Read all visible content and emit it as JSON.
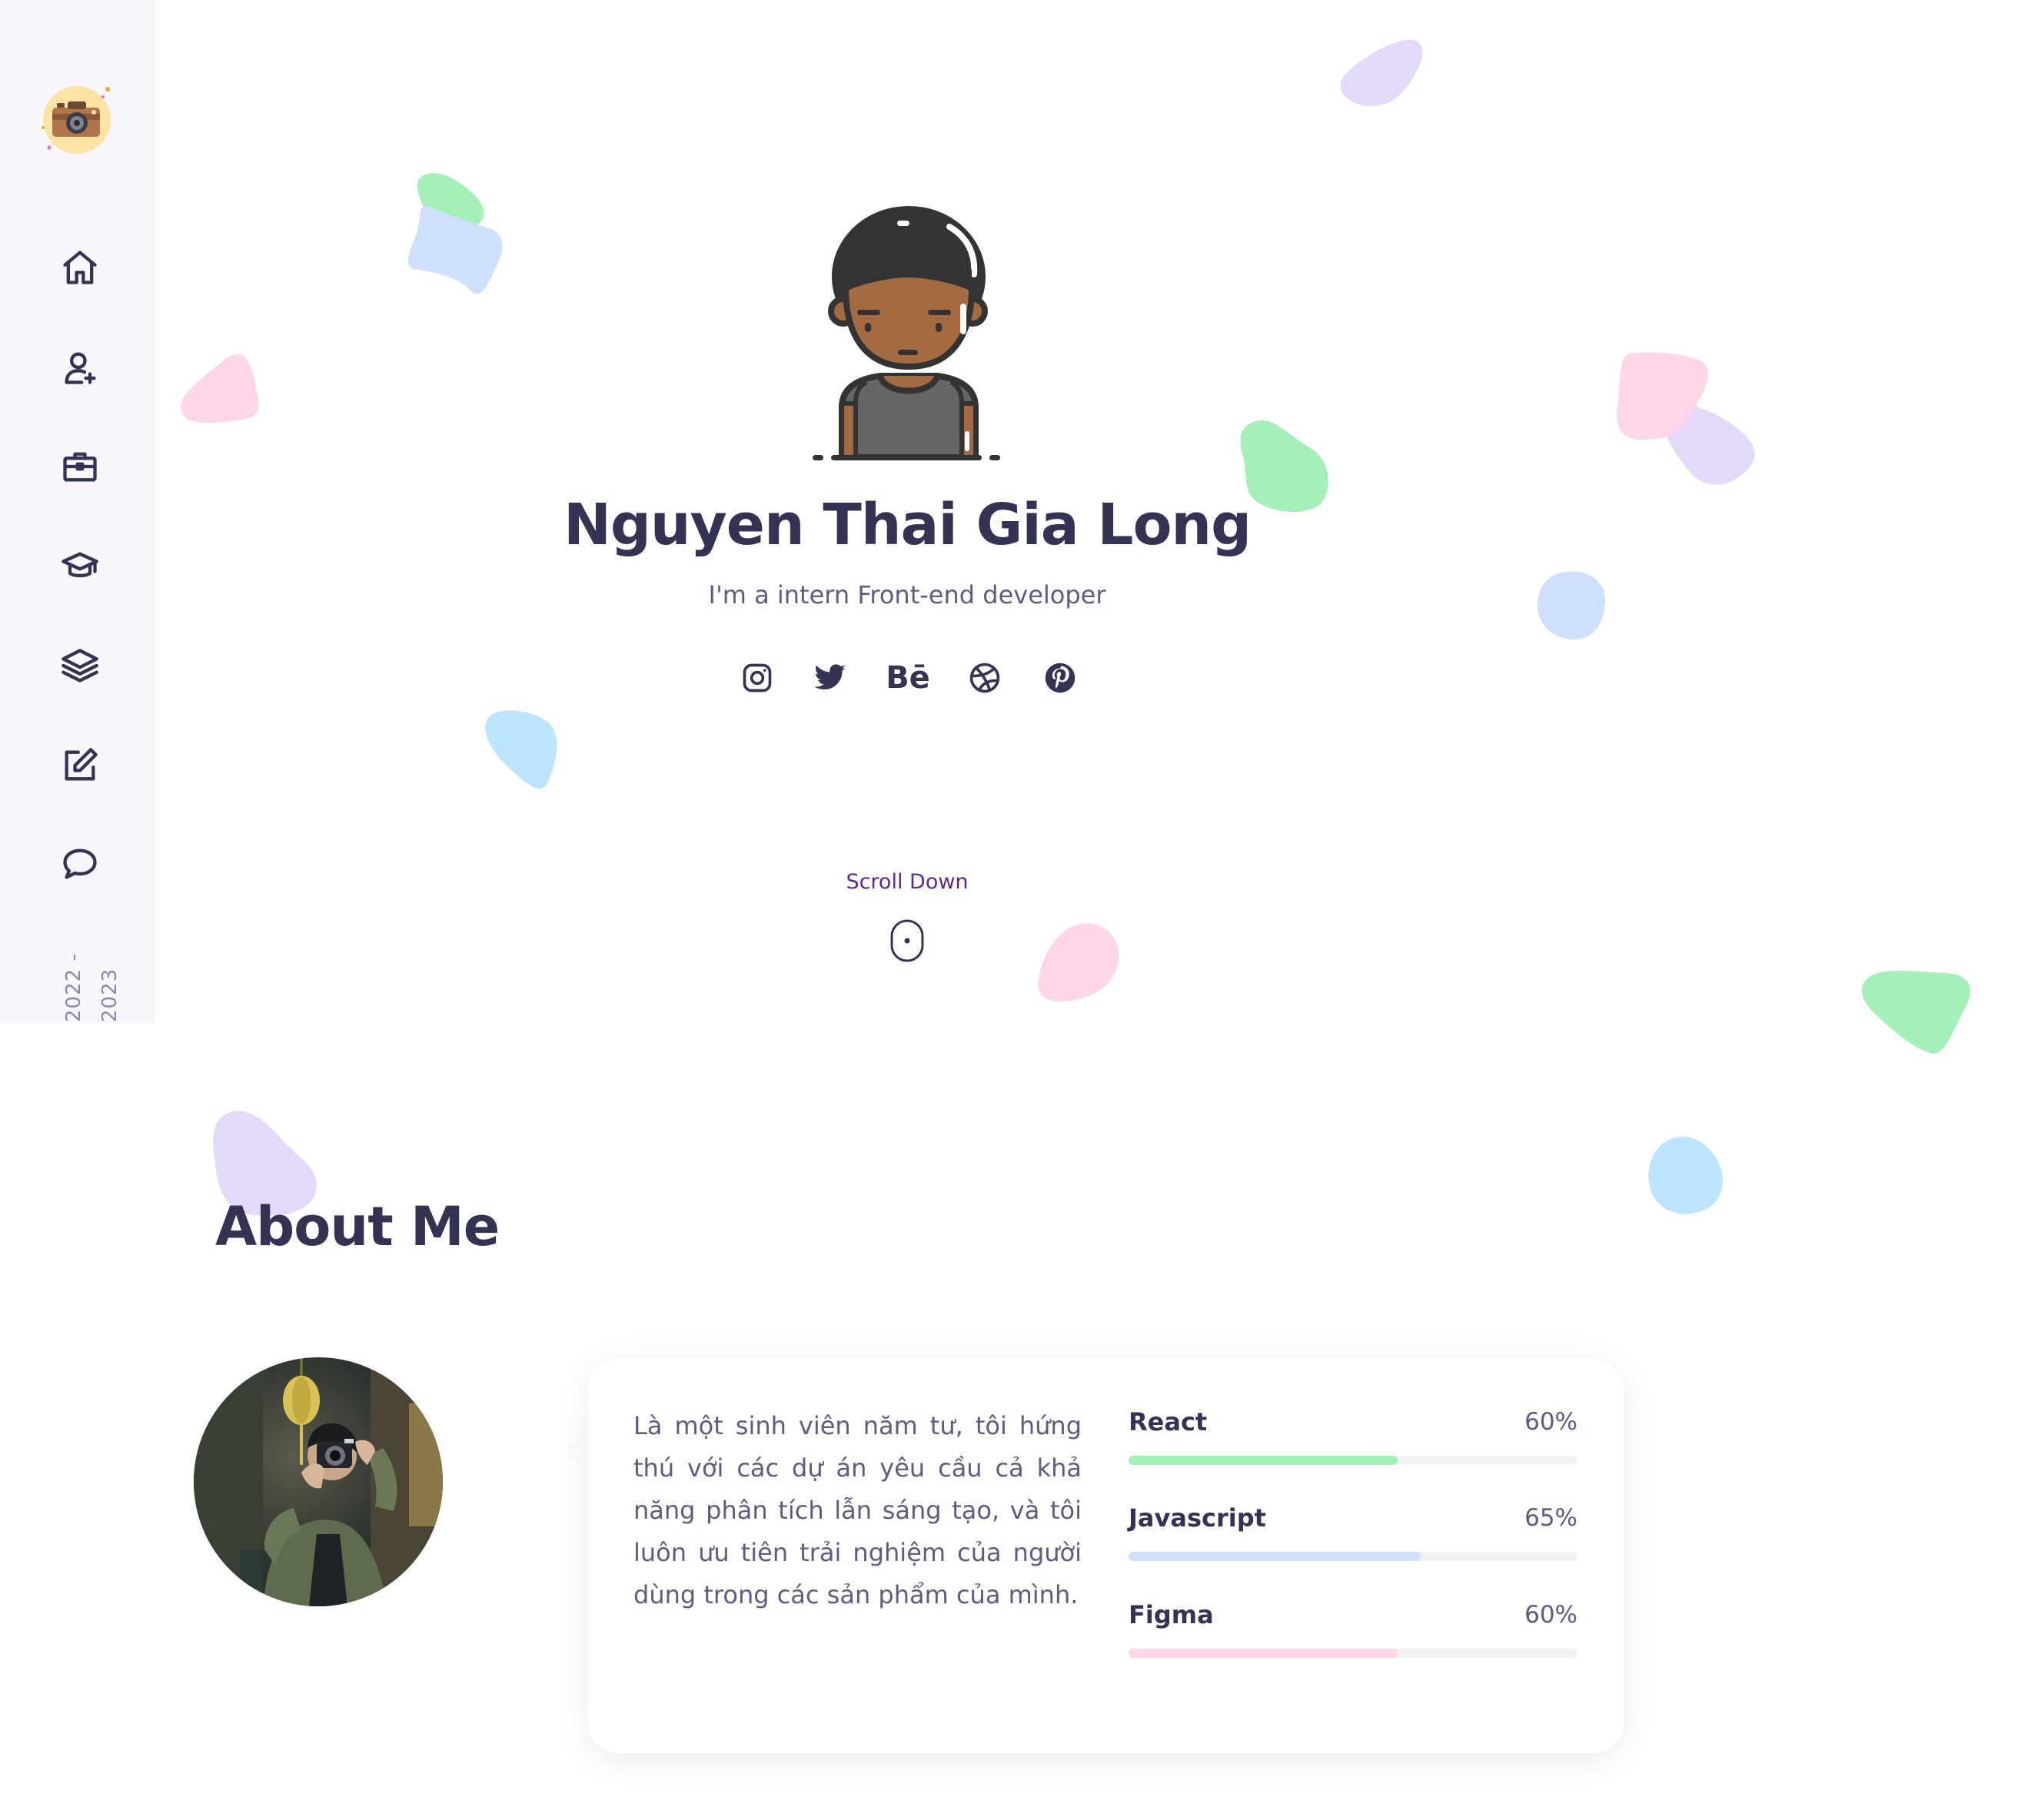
{
  "sidebar": {
    "nav": [
      {
        "id": "home",
        "icon": "home-icon"
      },
      {
        "id": "about",
        "icon": "user-plus-icon"
      },
      {
        "id": "services",
        "icon": "briefcase-icon"
      },
      {
        "id": "education",
        "icon": "graduation-cap-icon"
      },
      {
        "id": "portfolio",
        "icon": "layers-icon"
      },
      {
        "id": "blog",
        "icon": "edit-icon"
      },
      {
        "id": "contact",
        "icon": "chat-bubble-icon"
      }
    ],
    "copyright": {
      "line1": "2022 -",
      "line2": "2023"
    }
  },
  "hero": {
    "name": "Nguyen Thai Gia Long",
    "subtitle": "I'm a intern Front-end developer",
    "socials": [
      {
        "id": "instagram",
        "icon": "instagram-icon"
      },
      {
        "id": "twitter",
        "icon": "twitter-icon"
      },
      {
        "id": "behance",
        "icon": "behance-icon",
        "label": "Bē"
      },
      {
        "id": "dribbble",
        "icon": "dribbble-icon"
      },
      {
        "id": "pinterest",
        "icon": "pinterest-icon"
      }
    ],
    "scroll_label": "Scroll Down"
  },
  "about": {
    "title": "About Me",
    "bio": "Là một sinh viên năm tư, tôi hứng thú với các dự án yêu cầu cả khả năng phân tích lẫn sáng tạo, và tôi luôn ưu tiên trải nghiệm của người dùng trong các sản phẩm của mình.",
    "skills": [
      {
        "name": "React",
        "percent_label": "60%",
        "value": 60,
        "color": "#a3f2b6"
      },
      {
        "name": "Javascript",
        "percent_label": "65%",
        "value": 65,
        "color": "#cfe0fd"
      },
      {
        "name": "Figma",
        "percent_label": "60%",
        "value": 60,
        "color": "#fdd7e9"
      }
    ]
  },
  "colors": {
    "text_dark": "#353353",
    "text_muted": "#5e5c7f",
    "accent_purple": "#5d2a8e",
    "sidebar_bg": "#f9f6fe",
    "blob_green": "#a5f0b8",
    "blob_blue": "#cfe0fd",
    "blob_pink": "#fdd7e9",
    "blob_purple": "#e5d9fb",
    "blob_cyan": "#bce5fd"
  }
}
